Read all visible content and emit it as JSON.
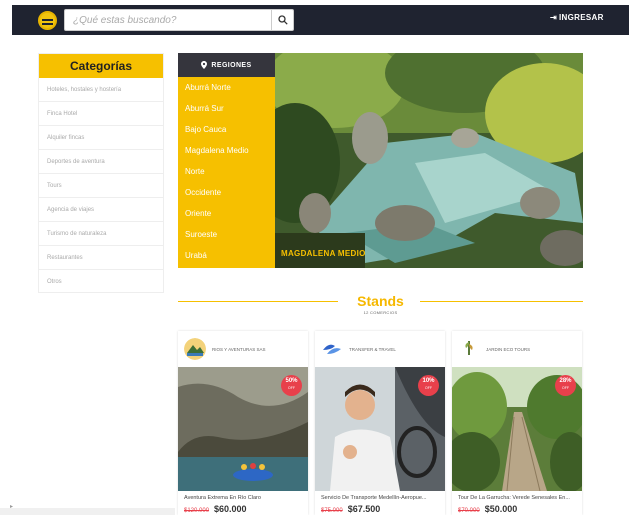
{
  "header": {
    "search_placeholder": "¿Qué estas buscando?",
    "login_label": "INGRESAR"
  },
  "categories": {
    "title": "Categorías",
    "items": [
      "Hoteles, hostales y hostería",
      "Finca Hotel",
      "Alquiler fincas",
      "Deportes de aventura",
      "Tours",
      "Agencia de viajes",
      "Turismo de naturaleza",
      "Restaurantes",
      "Otros"
    ]
  },
  "regions": {
    "title": "REGIONES",
    "items": [
      "Aburrá Norte",
      "Aburrá Sur",
      "Bajo Cauca",
      "Magdalena Medio",
      "Norte",
      "Occidente",
      "Oriente",
      "Suroeste",
      "Urabá"
    ]
  },
  "hero": {
    "caption": "MAGDALENA MEDIO"
  },
  "stands": {
    "title": "Stands",
    "subtitle": "12 COMERCIOS",
    "cards": [
      {
        "name": "RIOS Y AVENTURAS SAS",
        "discount": "50%",
        "discount_sub": "OFF",
        "title": "Aventura Extrema En Río Claro",
        "old_price": "$120.000",
        "new_price": "$60.000"
      },
      {
        "name": "TRANSFER & TRAVEL",
        "discount": "10%",
        "discount_sub": "OFF",
        "title": "Servicio De Transporte Medellín-Aeropue...",
        "old_price": "$75.000",
        "new_price": "$67.500"
      },
      {
        "name": "JARDIN ECO TOURS",
        "discount": "28%",
        "discount_sub": "OFF",
        "title": "Tour De La Garrucha: Verede Senesales En...",
        "old_price": "$70.000",
        "new_price": "$50.000"
      }
    ]
  },
  "colors": {
    "accent": "#f6c000",
    "topbar": "#1f2330",
    "badge": "#e8404b"
  }
}
